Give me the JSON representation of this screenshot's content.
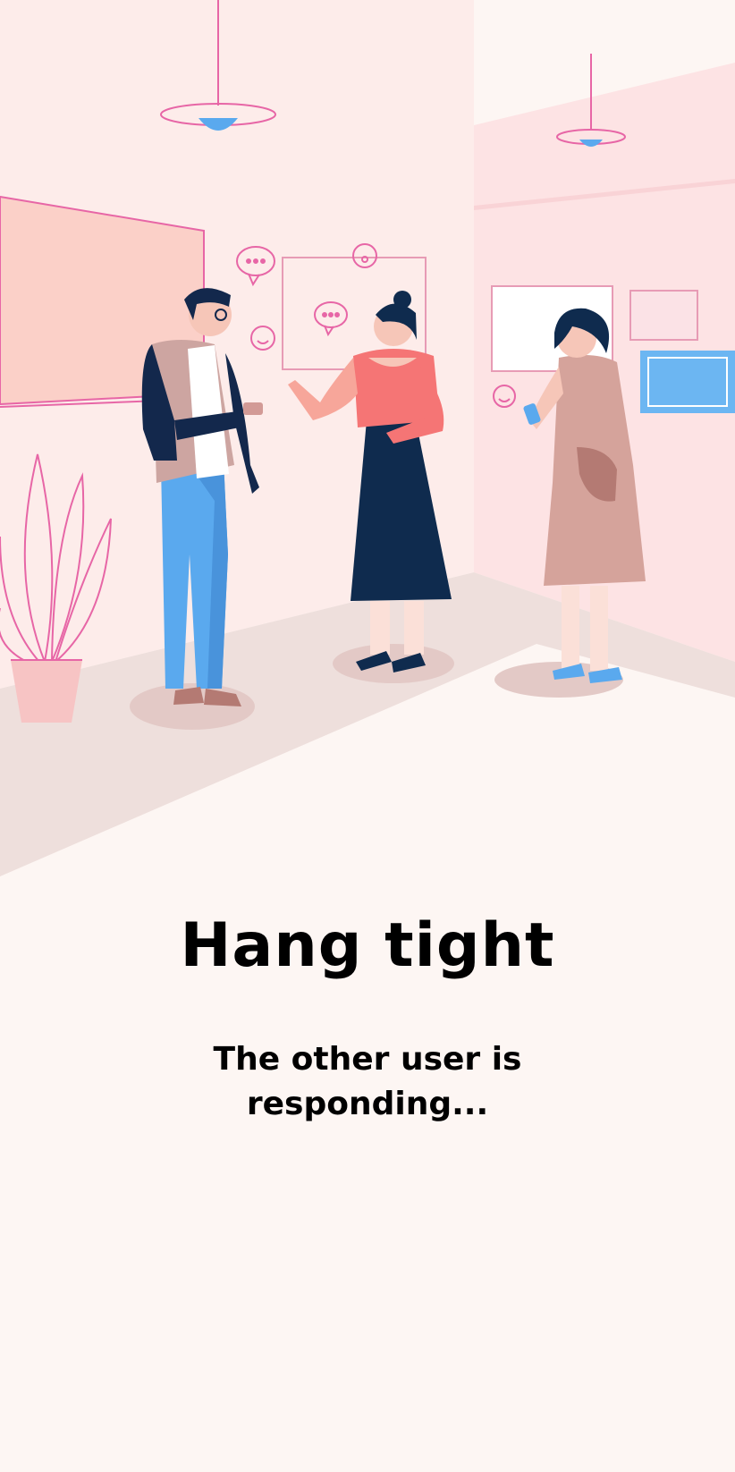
{
  "screen": {
    "title": "Hang tight",
    "message": "The other user is responding..."
  },
  "illustration": {
    "subject": "people-chatting-in-gallery",
    "icons": [
      "chat-bubble-icon",
      "smiley-icon"
    ]
  },
  "colors": {
    "background": "#fdf6f3",
    "wall_pink": "#fde7e6",
    "accent_pink": "#e766a6",
    "navy": "#0f2b4e",
    "blue": "#5aa9ee",
    "coral": "#f57575",
    "dress_rose": "#d5a39b"
  }
}
